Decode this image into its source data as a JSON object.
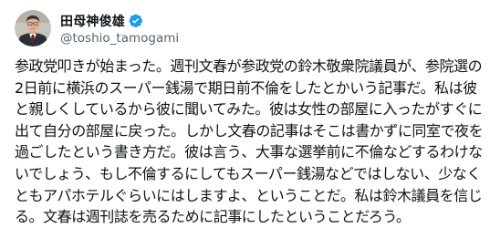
{
  "user": {
    "display_name": "田母神俊雄",
    "handle": "@toshio_tamogami",
    "verified": true,
    "avatar_icon": "profile-photo-man-in-suit",
    "verified_icon": "verified-badge-icon",
    "verified_color": "#1d9bf0"
  },
  "tweet": {
    "lines": [
      "参政党叩きが始まった。週刊文春が参政党の鈴木敬衆院議員が、参院選の",
      "2日前に横浜のスーパー銭湯で期日前不倫をしたとかいう記事だ。私は彼",
      "と親しくしているから彼に聞いてみた。彼は女性の部屋に入ったがすぐに",
      "出て自分の部屋に戻った。しかし文春の記事はそこは書かずに同室で夜を",
      "過ごしたという書き方だ。彼は言う、大事な選挙前に不倫などするわけな",
      "いでしょう、もし不倫するにしてもスーパー銭湯などではしない、少なく",
      "ともアパホテルぐらいにはしますよ、ということだ。私は鈴木議員を信じ",
      "る。文春は週刊誌を売るために記事にしたということだろう。"
    ]
  }
}
